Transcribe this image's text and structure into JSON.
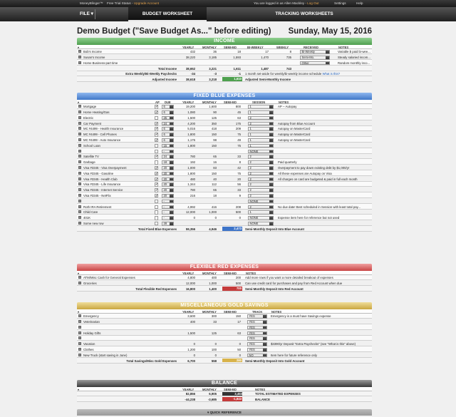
{
  "topbar": {
    "brand": "MoneyBlinger™",
    "trial": "Free Trial Status - ",
    "upgrade": "Upgrade Account",
    "logged": "You are logged in as Allen Mackley - ",
    "logout": "Log Out",
    "settings": "Settings",
    "help": "Help"
  },
  "nav": {
    "file": "FILE",
    "budget_tab": "BUDGET WORKSHEET",
    "tracking_tab": "TRACKING WORKSHEETS"
  },
  "page": {
    "title": "Demo Budget (\"Save Budget As...\" before editing)",
    "date": "Sunday, May 15, 2016"
  },
  "income": {
    "title": "INCOME",
    "headers": {
      "yearly": "YEARLY",
      "monthly": "MONTHLY",
      "semimo": "SEMI-MO",
      "biweekly": "BI-WEEKLY",
      "weekly": "WEEKLY",
      "received": "RECEIVED",
      "notes": "NOTES"
    },
    "rows": [
      {
        "name": "Bob's Income",
        "yearly": "432",
        "monthly": "36",
        "semimo": "18",
        "biweekly": "17",
        "weekly": "8",
        "received": "Bi-Weekly",
        "notes": "Variable $ paid bi-wee..."
      },
      {
        "name": "Susan's Income",
        "yearly": "38,220",
        "monthly": "3,185",
        "semimo": "1,593",
        "biweekly": "1,470",
        "weekly": "735",
        "received": "Semi-Mo.",
        "notes": "Steady salaried incom..."
      },
      {
        "name": "Home Business-part time",
        "yearly": "",
        "monthly": "",
        "semimo": "",
        "biweekly": "",
        "weekly": "",
        "received": "Other",
        "notes": "Random monthly inco..."
      }
    ],
    "total_label": "Total Income",
    "total": {
      "yearly": "38,652",
      "monthly": "3,221",
      "semimo": "1,611",
      "biweekly": "1,487",
      "weekly": "743"
    },
    "extra_label": "Extra Weekly/Bi-Weekly Paychecks",
    "extra": {
      "yearly": "-34",
      "monthly": "-3",
      "semimo": "-1"
    },
    "extra_note": "1 month set-aside for weekly/bi-weekly income schedule ",
    "extra_link": "What is this?",
    "adjusted_label": "Adjusted Income",
    "adjusted": {
      "yearly": "38,618",
      "monthly": "3,218",
      "semimo": "1,610"
    },
    "adjusted_note": "Adjusted Semi-Monthly Income"
  },
  "blue": {
    "title": "FIXED BLUE EXPENSES",
    "headers": {
      "ap": "AP",
      "due": "DUE",
      "yearly": "YEARLY",
      "monthly": "MONTHLY",
      "semimo": "SEMI-MO",
      "session": "SESSION",
      "notes": "NOTES"
    },
    "rows": [
      {
        "name": "Mortgage",
        "ap": "✓",
        "due": "6",
        "yearly": "19,200",
        "monthly": "1,600",
        "semimo": "800",
        "session": "1",
        "notes": "AP -- Autopay"
      },
      {
        "name": "Home Heating/Gas",
        "ap": "✓",
        "due": "6",
        "yearly": "1,080",
        "monthly": "90",
        "semimo": "45",
        "session": "1",
        "notes": ""
      },
      {
        "name": "Electric",
        "ap": "",
        "due": "25",
        "yearly": "1,500",
        "monthly": "125",
        "semimo": "63",
        "session": "2",
        "notes": ""
      },
      {
        "name": "Car Payment",
        "ap": "✓",
        "due": "24",
        "yearly": "4,200",
        "monthly": "350",
        "semimo": "175",
        "session": "2",
        "notes": "Autopay from Blue Account"
      },
      {
        "name": "MC #4499 - Health Insurance",
        "ap": "✓",
        "due": "6",
        "yearly": "5,016",
        "monthly": "418",
        "semimo": "209",
        "session": "1",
        "notes": "Autopay on MasterCard"
      },
      {
        "name": "MC #4499 - Cell Phones",
        "ap": "✓",
        "due": "6",
        "yearly": "1,800",
        "monthly": "150",
        "semimo": "75",
        "session": "1",
        "notes": "Autopay on MasterCard"
      },
      {
        "name": "MC #4499 - Auto Insurance",
        "ap": "✓",
        "due": "6",
        "yearly": "1,176",
        "monthly": "98",
        "semimo": "49",
        "session": "1",
        "notes": "Autopay on MasterCard"
      },
      {
        "name": "School Loan",
        "ap": "",
        "due": "15",
        "yearly": "1,800",
        "monthly": "150",
        "semimo": "75",
        "session": "1",
        "notes": ""
      },
      {
        "name": "",
        "ap": "",
        "due": "-",
        "yearly": "",
        "monthly": "",
        "semimo": "",
        "session": "NONE",
        "notes": ""
      },
      {
        "name": "Satellite TV",
        "ap": "✓",
        "due": "24",
        "yearly": "780",
        "monthly": "65",
        "semimo": "33",
        "session": "2",
        "notes": ""
      },
      {
        "name": "Garbage",
        "ap": "",
        "due": "18",
        "yearly": "192",
        "monthly": "16",
        "semimo": "8",
        "session": "2",
        "notes": "Paid quarterly"
      },
      {
        "name": "Visa #3345 - Visa Overpayment",
        "ap": "✓",
        "due": "20",
        "yearly": "1,000",
        "monthly": "83",
        "semimo": "42",
        "session": "2",
        "notes": "Overpayment to pay down existing debt by $1,000/yr"
      },
      {
        "name": "Visa #3345 - Gasoline",
        "ap": "✓",
        "due": "20",
        "yearly": "1,800",
        "monthly": "150",
        "semimo": "75",
        "session": "2",
        "notes": "All these expenses are Autopay on Visa"
      },
      {
        "name": "Visa #3345 - Health Club",
        "ap": "✓",
        "due": "20",
        "yearly": "480",
        "monthly": "40",
        "semimo": "20",
        "session": "2",
        "notes": "All charges on card are budgeted & paid in full each month"
      },
      {
        "name": "Visa #3345 - Life Insurance",
        "ap": "✓",
        "due": "20",
        "yearly": "1,344",
        "monthly": "112",
        "semimo": "56",
        "session": "2",
        "notes": ""
      },
      {
        "name": "Visa #3345 - Internet Service",
        "ap": "✓",
        "due": "20",
        "yearly": "780",
        "monthly": "65",
        "semimo": "33",
        "session": "2",
        "notes": ""
      },
      {
        "name": "Visa #3345 - NetFlix",
        "ap": "✓",
        "due": "20",
        "yearly": "216",
        "monthly": "18",
        "semimo": "9",
        "session": "2",
        "notes": ""
      },
      {
        "name": "",
        "ap": "",
        "due": "-",
        "yearly": "",
        "monthly": "",
        "semimo": "",
        "session": "NONE",
        "notes": ""
      },
      {
        "name": "Roth IRA Retirement",
        "ap": "",
        "due": "-",
        "yearly": "4,992",
        "monthly": "416",
        "semimo": "208",
        "session": "2",
        "notes": "No due date! Best scheduled in Session with least total pay..."
      },
      {
        "name": "Child Care",
        "ap": "",
        "due": "-",
        "yearly": "12,000",
        "monthly": "1,000",
        "semimo": "500",
        "session": "1",
        "notes": ""
      },
      {
        "name": "401K",
        "ap": "",
        "due": "-",
        "yearly": "0",
        "monthly": "0",
        "semimo": "0",
        "session": "NONE",
        "notes": "Expense item here for reference but not used"
      },
      {
        "name": "Some new row",
        "ap": "",
        "due": "28",
        "yearly": "",
        "monthly": "",
        "semimo": "",
        "session": "NONE",
        "notes": ""
      }
    ],
    "total_label": "Total Fixed Blue Expenses",
    "total": {
      "yearly": "59,356",
      "monthly": "4,946",
      "semimo": "2,473"
    },
    "total_note": "Semi-Monthly Deposit Into Blue Account"
  },
  "red": {
    "title": "FLEXIBLE RED EXPENSES",
    "headers": {
      "yearly": "YEARLY",
      "monthly": "MONTHLY",
      "semimo": "SEMI-MO",
      "notes": "NOTES"
    },
    "rows": [
      {
        "name": "ATM/Misc Cash for General Expenses",
        "yearly": "4,800",
        "monthly": "400",
        "semimo": "200",
        "notes": "Add more rows if you want a more detailed breakout of expenses"
      },
      {
        "name": "Groceries",
        "yearly": "12,000",
        "monthly": "1,000",
        "semimo": "500",
        "notes": "Can use credit card for purchases and pay from Red Account when due"
      }
    ],
    "total_label": "Total Flexible Red Expenses",
    "total": {
      "yearly": "16,800",
      "monthly": "1,400",
      "semimo": "700"
    },
    "total_note": "Semi-Monthly Deposit Into Red Account"
  },
  "gold": {
    "title": "MISCELLANEOUS GOLD SAVINGS",
    "headers": {
      "yearly": "YEARLY",
      "monthly": "MONTHLY",
      "semimo": "SEMI-MO",
      "track": "TRACK",
      "notes": "NOTES"
    },
    "rows": [
      {
        "name": "Emergency",
        "yearly": "3,600",
        "monthly": "300",
        "semimo": "150",
        "track": "YES",
        "notes": "Emergency is a must have Savings expense"
      },
      {
        "name": "Veterinarian",
        "yearly": "400",
        "monthly": "33",
        "semimo": "17",
        "track": "YES",
        "notes": ""
      },
      {
        "name": "",
        "yearly": "",
        "monthly": "",
        "semimo": "",
        "track": "YES",
        "notes": ""
      },
      {
        "name": "Holiday Gifts",
        "yearly": "1,500",
        "monthly": "125",
        "semimo": "63",
        "track": "YES",
        "notes": ""
      },
      {
        "name": "",
        "yearly": "",
        "monthly": "",
        "semimo": "",
        "track": "YES",
        "notes": ""
      },
      {
        "name": "Vacation",
        "yearly": "0",
        "monthly": "0",
        "semimo": "0",
        "track": "YES",
        "notes": "$3390/yr Deposit \"Extra Paychecks\" (see \"What is this\" above)"
      },
      {
        "name": "Clothes",
        "yearly": "1,200",
        "monthly": "100",
        "semimo": "50",
        "track": "YES",
        "notes": ""
      },
      {
        "name": "New Truck (start saving in June)",
        "yearly": "0",
        "monthly": "0",
        "semimo": "0",
        "track": "NO",
        "notes": "Item here for future reference only"
      }
    ],
    "total_label": "Total Savings/Misc Gold Expenses",
    "total": {
      "yearly": "6,700",
      "monthly": "558",
      "semimo": "280"
    },
    "total_note": "Semi-Monthly Deposit Into Gold Account"
  },
  "balance": {
    "title": "BALANCE",
    "headers": {
      "yearly": "YEARLY",
      "monthly": "MONTHLY",
      "semimo": "SEMI-MO",
      "notes": "NOTES"
    },
    "rows": [
      {
        "yearly": "82,856",
        "monthly": "6,905",
        "semimo": "3,453",
        "notes": "TOTAL ESTIMATED EXPENSES"
      },
      {
        "yearly": "-44,238",
        "monthly": "-3,685",
        "semimo": "-1,843",
        "notes": "BALANCE"
      }
    ]
  },
  "quick_ref": "QUICK REFERENCE",
  "colors": {
    "income": "#5aa85a",
    "blue": "#3f77c7",
    "red": "#c84444",
    "gold": "#c9a640",
    "balance": "#3a3a3a"
  }
}
